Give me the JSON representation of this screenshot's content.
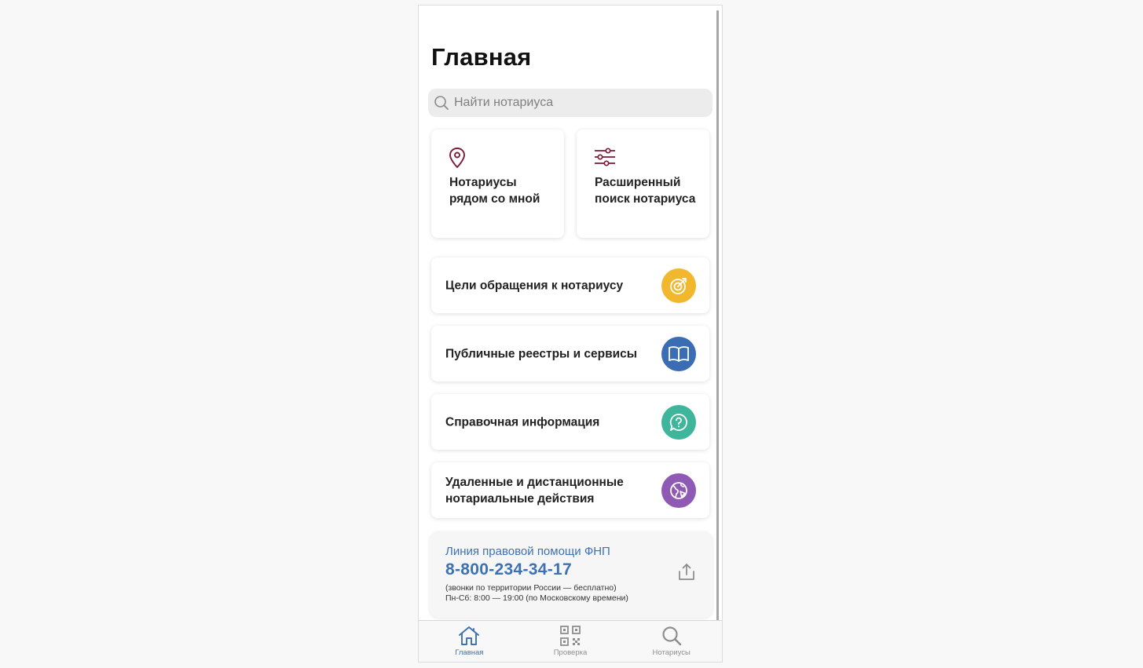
{
  "page": {
    "title": "Главная"
  },
  "search": {
    "placeholder": "Найти нотариуса"
  },
  "tiles": [
    {
      "label": "Нотариусы рядом со мной",
      "icon": "location-pin-icon"
    },
    {
      "label": "Расширенный поиск нотариуса",
      "icon": "filter-sliders-icon"
    }
  ],
  "menu": [
    {
      "label": "Цели обращения к нотариусу",
      "icon": "target-icon",
      "color": "#f1b82f"
    },
    {
      "label": "Публичные реестры и сервисы",
      "icon": "book-icon",
      "color": "#3a6db3"
    },
    {
      "label": "Справочная информация",
      "icon": "question-chat-icon",
      "color": "#3fb59c"
    },
    {
      "label": "Удаленные и дистанционные нотариальные действия",
      "icon": "globe-icon",
      "color": "#8f5ab3"
    }
  ],
  "helpline": {
    "title": "Линия правовой помощи ФНП",
    "phone": "8-800-234-34-17",
    "note1": "(звонки по территории России — бесплатно)",
    "note2": "Пн-Сб: 8:00 — 19:00 (по Московскому времени)"
  },
  "tabbar": [
    {
      "label": "Главная",
      "icon": "home-icon",
      "active": true
    },
    {
      "label": "Проверка",
      "icon": "qr-code-icon",
      "active": false
    },
    {
      "label": "Нотариусы",
      "icon": "search-icon",
      "active": false
    }
  ],
  "colors": {
    "accent": "#3c72b5",
    "tile_icon": "#7a1a34"
  }
}
